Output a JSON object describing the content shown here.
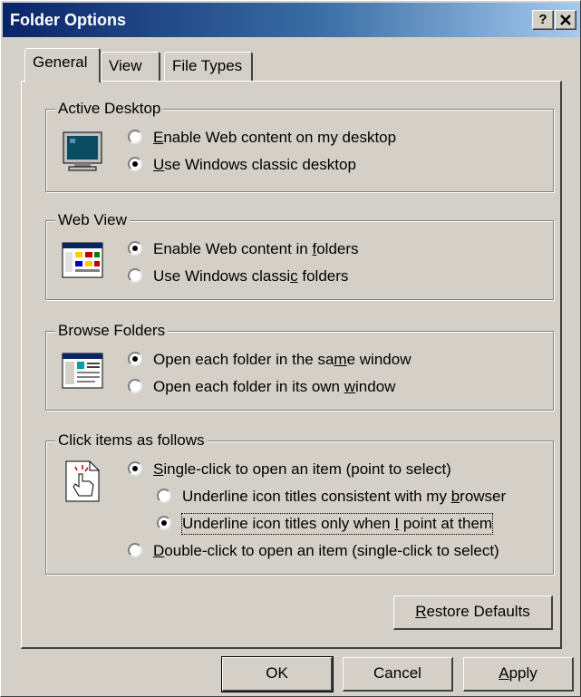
{
  "window": {
    "title": "Folder Options",
    "help_button": "?",
    "close_button": "X"
  },
  "tabs": [
    {
      "label": "General",
      "active": true
    },
    {
      "label": "View",
      "active": false
    },
    {
      "label": "File Types",
      "active": false
    }
  ],
  "groups": {
    "active_desktop": {
      "title": "Active Desktop",
      "icon": "monitor-icon",
      "options": [
        {
          "pre": "",
          "key": "E",
          "post": "nable Web content on my desktop",
          "checked": false
        },
        {
          "pre": "",
          "key": "U",
          "post": "se Windows classic desktop",
          "checked": true
        }
      ]
    },
    "web_view": {
      "title": "Web View",
      "icon": "web-folder-icon",
      "options": [
        {
          "pre": "Enable Web content in ",
          "key": "f",
          "post": "olders",
          "checked": true
        },
        {
          "pre": "Use Windows classi",
          "key": "c",
          "post": " folders",
          "checked": false
        }
      ]
    },
    "browse_folders": {
      "title": "Browse Folders",
      "icon": "window-browse-icon",
      "options": [
        {
          "pre": "Open each folder in the sa",
          "key": "m",
          "post": "e window",
          "checked": true
        },
        {
          "pre": "Open each folder in its own ",
          "key": "w",
          "post": "indow",
          "checked": false
        }
      ]
    },
    "click_items": {
      "title": "Click items as follows",
      "icon": "hand-cursor-icon",
      "options": [
        {
          "pre": "",
          "key": "S",
          "post": "ingle-click to open an item (point to select)",
          "checked": true
        },
        {
          "pre": "Underline icon titles consistent with my ",
          "key": "b",
          "post": "rowser",
          "checked": false
        },
        {
          "pre": "Underline icon titles only when ",
          "key": "I",
          "post": " point at them",
          "checked": true
        },
        {
          "pre": "",
          "key": "D",
          "post": "ouble-click to open an item (single-click to select)",
          "checked": false
        }
      ]
    }
  },
  "restore_defaults": {
    "pre": "",
    "key": "R",
    "post": "estore Defaults"
  },
  "buttons": {
    "ok": "OK",
    "cancel": "Cancel",
    "apply": {
      "pre": "",
      "key": "A",
      "post": "pply"
    }
  }
}
